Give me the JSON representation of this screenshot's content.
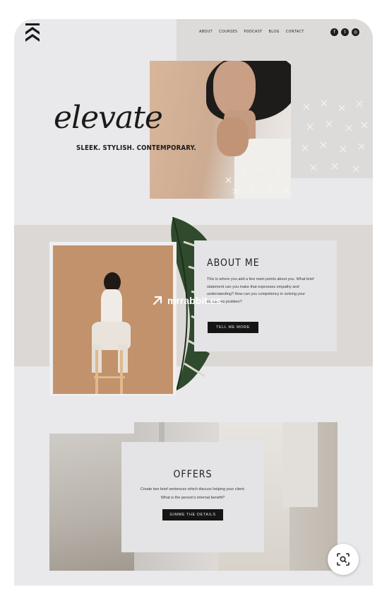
{
  "nav": {
    "items": [
      "ABOUT",
      "COURSES",
      "PODCAST",
      "BLOG",
      "CONTACT"
    ],
    "social": [
      "f",
      "t",
      "◎"
    ]
  },
  "hero": {
    "script": "elevate",
    "tagline": "SLEEK. STYLISH. CONTEMPORARY."
  },
  "about": {
    "title": "ABOUT ME",
    "text": "This is where you add a few main points about you. What brief statement can you make that expresses empathy and understanding? How can you competency in solving your customers problem?",
    "button": "TELL ME MORE"
  },
  "watermark": {
    "text": "mrrabbit.es"
  },
  "offers": {
    "title": "OFFERS",
    "line1": "Create two brief sentences which discuss helping your client.",
    "line2": "What is the person's internal benefit?",
    "button": "GIMME THE DETAILS"
  },
  "colors": {
    "accent_dark": "#151515",
    "blush_band": "#dcd8d5",
    "page_bg": "#e9e9eb"
  }
}
